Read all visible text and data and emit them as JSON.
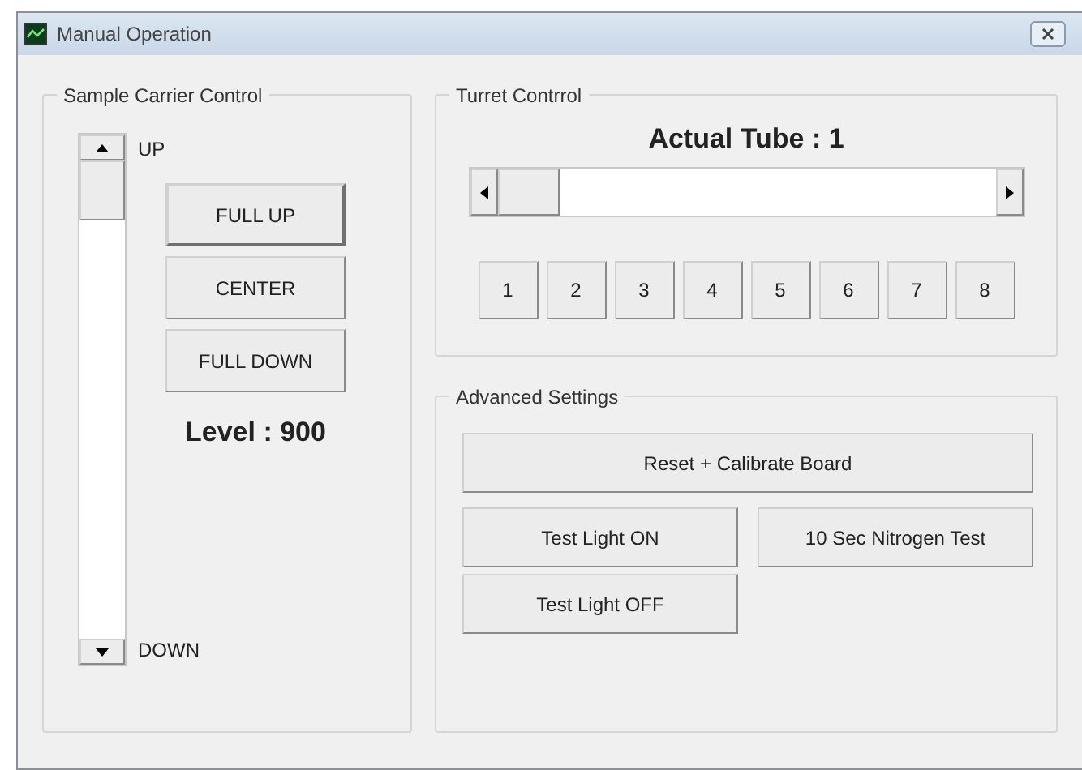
{
  "window": {
    "title": "Manual Operation"
  },
  "sample_carrier": {
    "title": "Sample Carrier Control",
    "up_label": "UP",
    "down_label": "DOWN",
    "buttons": [
      {
        "label": "FULL UP",
        "focused": true
      },
      {
        "label": "CENTER",
        "focused": false
      },
      {
        "label": "FULL DOWN",
        "focused": false
      }
    ],
    "level_text": "Level : 900"
  },
  "turret": {
    "title": "Turret Contrrol",
    "actual_tube": "Actual Tube : 1",
    "tube_buttons": [
      "1",
      "2",
      "3",
      "4",
      "5",
      "6",
      "7",
      "8"
    ]
  },
  "advanced": {
    "title": "Advanced Settings",
    "buttons": [
      "Reset + Calibrate Board",
      "Test Light ON",
      "10 Sec Nitrogen Test",
      "Test Light OFF"
    ]
  }
}
